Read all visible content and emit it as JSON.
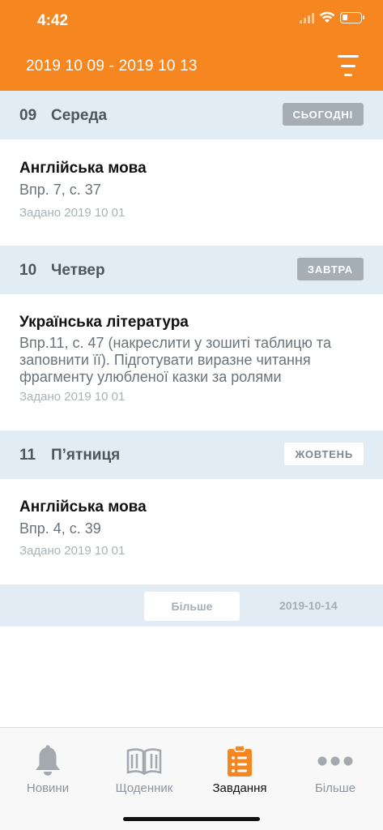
{
  "status": {
    "time": "4:42"
  },
  "header": {
    "date_range": "2019 10 09 - 2019 10 13"
  },
  "days": [
    {
      "num": "09",
      "name": "Середа",
      "badge": "СЬОГОДНІ"
    },
    {
      "num": "10",
      "name": "Четвер",
      "badge": "ЗАВТРА"
    },
    {
      "num": "11",
      "name": "П’ятниця",
      "badge": "ЖОВТЕНЬ"
    }
  ],
  "homework": [
    {
      "subject": "Англійська мова",
      "task": "Впр. 7, с. 37",
      "assigned": "Задано 2019 10 01"
    },
    {
      "subject": "Українська література",
      "task": "Впр.11, с. 47 (накреслити у зошиті таблицю та заповнити її). Підготувати виразне читання фрагменту улюбленої казки за ролями",
      "assigned": "Задано 2019 10 01"
    },
    {
      "subject": "Англійська мова",
      "task": "Впр. 4, с. 39",
      "assigned": "Задано 2019 10 01"
    }
  ],
  "more": {
    "button_label": "Більше",
    "next_date": "2019-10-14"
  },
  "tabs": [
    {
      "label": "Новини",
      "icon": "bell-icon"
    },
    {
      "label": "Щоденник",
      "icon": "book-icon"
    },
    {
      "label": "Завдання",
      "icon": "clipboard-icon",
      "active": true
    },
    {
      "label": "Більше",
      "icon": "more-dots-icon"
    }
  ],
  "colors": {
    "accent": "#f58620",
    "section_bg": "#e1ecf4",
    "badge_grey": "#a5aeb5"
  }
}
